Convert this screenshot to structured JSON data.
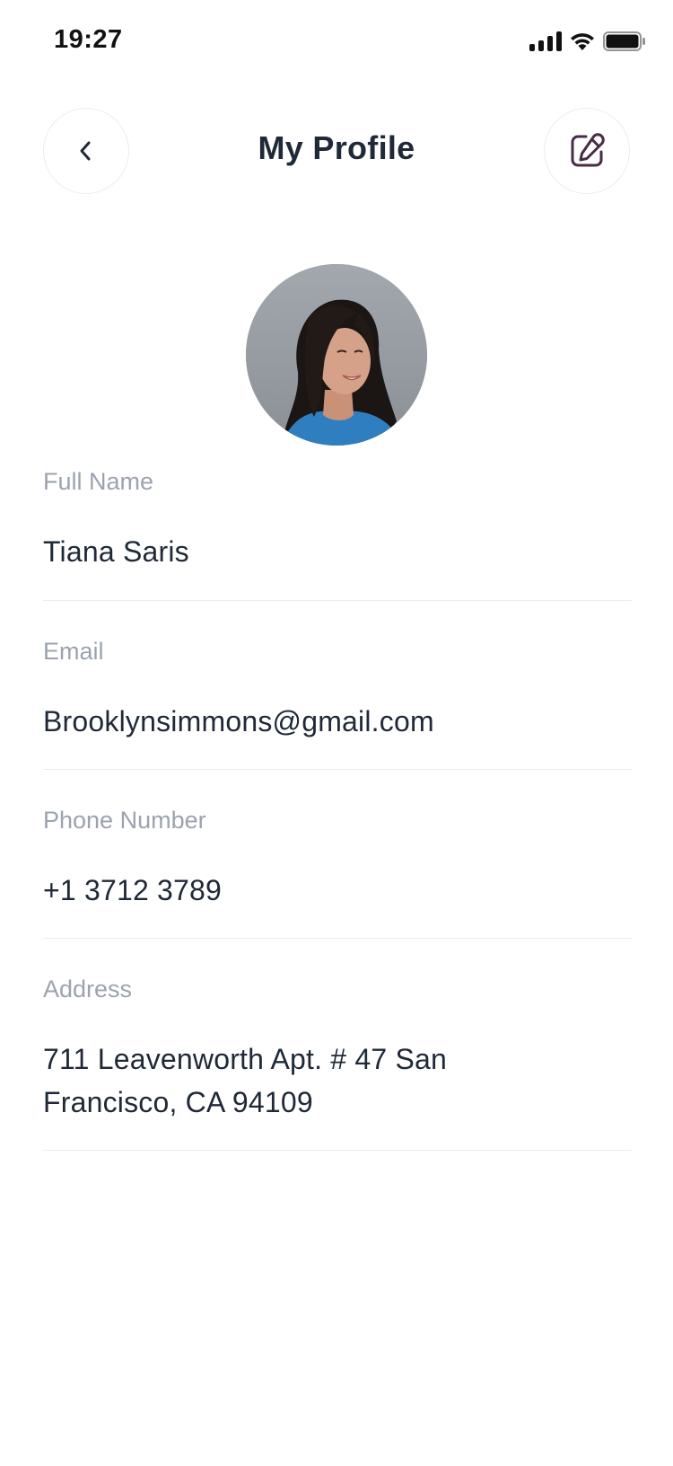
{
  "status_bar": {
    "time": "19:27",
    "icons": [
      "signal-icon",
      "wifi-icon",
      "battery-icon"
    ]
  },
  "header": {
    "title": "My Profile",
    "back_icon": "chevron-left-icon",
    "edit_icon": "edit-icon"
  },
  "profile": {
    "fields": [
      {
        "label": "Full Name",
        "value": "Tiana Saris"
      },
      {
        "label": "Email",
        "value": "Brooklynsimmons@gmail.com"
      },
      {
        "label": "Phone Number",
        "value": "+1 3712 3789"
      },
      {
        "label": "Address",
        "value": "711 Leavenworth Apt. # 47 San Francisco, CA 94109"
      }
    ]
  },
  "colors": {
    "text_primary": "#1f2937",
    "text_label": "#9ca3af",
    "divider": "#ececef",
    "edit_icon": "#4a2b45",
    "avatar_shirt": "#2f7fc0"
  }
}
